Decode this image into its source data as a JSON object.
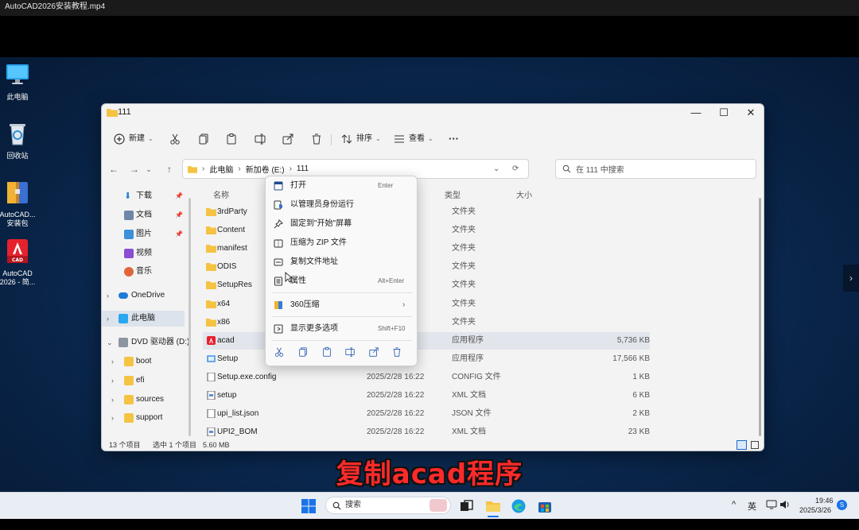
{
  "video_title": "AutoCAD2026安装教程.mp4",
  "desktop_icons": [
    {
      "label": "此电脑"
    },
    {
      "label": "回收站"
    },
    {
      "label": "AutoCAD... 安装包"
    },
    {
      "label": "AutoCAD 2026 - 简..."
    }
  ],
  "cad_badge": "CAD",
  "explorer": {
    "title": "111",
    "window_controls": {
      "minimize": "—",
      "maximize": "☐",
      "close": "✕"
    },
    "toolbar": {
      "new_label": "新建",
      "sort_label": "排序",
      "view_label": "查看",
      "more_label": "···"
    },
    "nav": {
      "back": "←",
      "forward": "→",
      "up": "↑",
      "recent": "⌄",
      "refresh": "⟳"
    },
    "address": {
      "segments": [
        "此电脑",
        "新加卷 (E:)",
        "111"
      ],
      "separator": "›"
    },
    "search": {
      "placeholder": "在 111 中搜索"
    },
    "sidebar": [
      {
        "label": "下载"
      },
      {
        "label": "文档"
      },
      {
        "label": "图片"
      },
      {
        "label": "视频"
      },
      {
        "label": "音乐"
      },
      {
        "label": "OneDrive"
      },
      {
        "label": "此电脑"
      },
      {
        "label": "DVD 驱动器 (D:)"
      },
      {
        "label": "boot"
      },
      {
        "label": "efi"
      },
      {
        "label": "sources"
      },
      {
        "label": "support"
      }
    ],
    "columns": {
      "name": "名称",
      "type": "类型",
      "size": "大小"
    },
    "files": [
      {
        "name": "3rdParty",
        "date": "",
        "type": "文件夹",
        "size": ""
      },
      {
        "name": "Content",
        "date": "",
        "type": "文件夹",
        "size": ""
      },
      {
        "name": "manifest",
        "date": "",
        "type": "文件夹",
        "size": ""
      },
      {
        "name": "ODIS",
        "date": "",
        "type": "文件夹",
        "size": ""
      },
      {
        "name": "SetupRes",
        "date": "",
        "type": "文件夹",
        "size": ""
      },
      {
        "name": "x64",
        "date": "",
        "type": "文件夹",
        "size": ""
      },
      {
        "name": "x86",
        "date": "",
        "type": "文件夹",
        "size": ""
      },
      {
        "name": "acad",
        "date": "",
        "type": "应用程序",
        "size": "5,736 KB"
      },
      {
        "name": "Setup",
        "date": "",
        "type": "应用程序",
        "size": "17,566 KB"
      },
      {
        "name": "Setup.exe.config",
        "date": "2025/2/28 16:22",
        "type": "CONFIG 文件",
        "size": "1 KB"
      },
      {
        "name": "setup",
        "date": "2025/2/28 16:22",
        "type": "XML 文档",
        "size": "6 KB"
      },
      {
        "name": "upi_list.json",
        "date": "2025/2/28 16:22",
        "type": "JSON 文件",
        "size": "2 KB"
      },
      {
        "name": "UPI2_BOM",
        "date": "2025/2/28 16:22",
        "type": "XML 文档",
        "size": "23 KB"
      }
    ],
    "status": {
      "count": "13 个项目",
      "selected": "选中 1 个项目",
      "size": "5.60 MB"
    }
  },
  "context_menu": {
    "items": [
      {
        "label": "打开",
        "shortcut": "Enter"
      },
      {
        "label": "以管理员身份运行",
        "shortcut": ""
      },
      {
        "label": "固定到\"开始\"屏幕",
        "shortcut": ""
      },
      {
        "label": "压缩为 ZIP 文件",
        "shortcut": ""
      },
      {
        "label": "复制文件地址",
        "shortcut": ""
      },
      {
        "label": "属性",
        "shortcut": "Alt+Enter"
      },
      {
        "label": "360压缩",
        "shortcut": "",
        "arrow": "›"
      },
      {
        "label": "显示更多选项",
        "shortcut": "Shift+F10"
      }
    ]
  },
  "subtitle": "复制acad程序",
  "taskbar": {
    "search_label": "搜索",
    "tray": {
      "chevron": "^",
      "ime": "英",
      "time": "19:46",
      "date": "2025/3/26",
      "badge": "S"
    }
  },
  "colors": {
    "folder": "#f5c343",
    "accent": "#0067c0",
    "subtitle": "#ff2a2a"
  }
}
